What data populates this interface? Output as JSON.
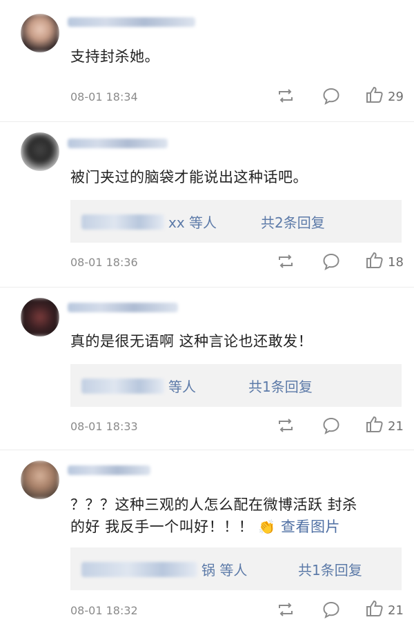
{
  "comments": [
    {
      "text": "支持封杀她。",
      "time": "08-01 18:34",
      "likes": "29"
    },
    {
      "text": "被门夹过的脑袋才能说出这种话吧。",
      "replies": {
        "names_suffix": "xx 等人",
        "total": "共2条回复"
      },
      "time": "08-01 18:36",
      "likes": "18"
    },
    {
      "text": "真的是很无语啊 这种言论也还敢发！",
      "replies": {
        "names_suffix": "等人",
        "total": "共1条回复"
      },
      "time": "08-01 18:33",
      "likes": "21"
    },
    {
      "text_line1": "？？？这种三观的人怎么配在微博活跃 封杀",
      "text_line2": "的好 我反手一个叫好！！！",
      "emoji": "👏",
      "link": "查看图片",
      "replies": {
        "names_suffix": "锅 等人",
        "total": "共1条回复"
      },
      "time": "08-01 18:32",
      "likes": "21"
    }
  ],
  "icons": [
    "repost-icon",
    "comment-icon",
    "like-icon"
  ],
  "colors": {
    "link": "#4f6fa3",
    "meta": "#8a8a8a",
    "reply_bg": "#f2f2f2"
  }
}
